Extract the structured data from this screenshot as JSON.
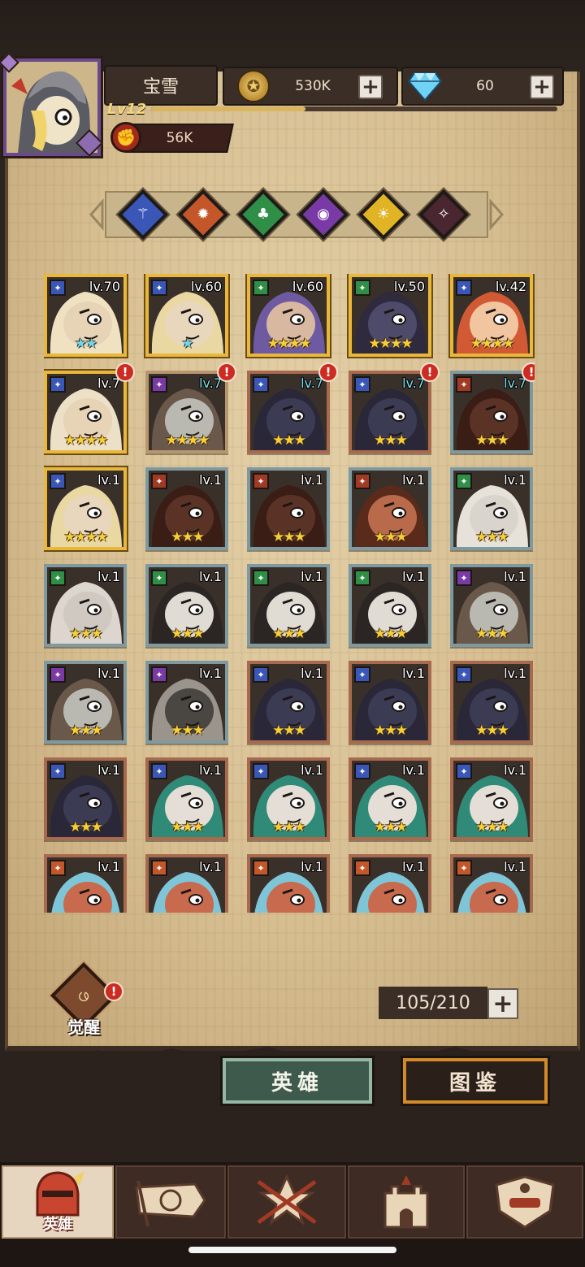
{
  "player": {
    "name": "宝雪",
    "level": "Lv12",
    "power": "56K",
    "xp_fraction": 0.38
  },
  "currencies": {
    "gold": "530K",
    "gems": "60"
  },
  "filters": [
    {
      "name": "filter-class-1",
      "color": "#3a57b8",
      "glyph": "⚚"
    },
    {
      "name": "filter-class-2",
      "color": "#c4572a",
      "glyph": "✹"
    },
    {
      "name": "filter-class-3",
      "color": "#2f8f46",
      "glyph": "♣"
    },
    {
      "name": "filter-class-4",
      "color": "#7a3aa6",
      "glyph": "◉"
    },
    {
      "name": "filter-class-5",
      "color": "#e1b425",
      "glyph": "☀"
    },
    {
      "name": "filter-class-6",
      "color": "#4a2630",
      "glyph": "✧"
    }
  ],
  "heroes": [
    {
      "level": "lv.70",
      "stars": "★★",
      "frame": "gold",
      "cls": "#3a57b8",
      "alert": false,
      "skin": "#e7d3b6",
      "hair": "#f0e2c0",
      "starcolor": "cyan"
    },
    {
      "level": "lv.60",
      "stars": "★",
      "frame": "gold",
      "cls": "#3a57b8",
      "alert": false,
      "skin": "#e8d7bd",
      "hair": "#ead8a3",
      "starcolor": "cyan"
    },
    {
      "level": "lv.60",
      "stars": "★★★★",
      "frame": "gold",
      "cls": "#2f8f46",
      "alert": false,
      "skin": "#d8b8a0",
      "hair": "#6e5aa0"
    },
    {
      "level": "lv.50",
      "stars": "★★★★",
      "frame": "gold",
      "cls": "#2f8f46",
      "alert": false,
      "skin": "#4e4a6a",
      "hair": "#2f2a3e"
    },
    {
      "level": "lv.42",
      "stars": "★★★★",
      "frame": "gold",
      "cls": "#3a57b8",
      "alert": false,
      "skin": "#f0c5a0",
      "hair": "#d15a34"
    },
    {
      "level": "lv.7",
      "stars": "★★★★",
      "frame": "gold",
      "cls": "#3a57b8",
      "alert": true,
      "skin": "#e7d3b6",
      "hair": "#ece0c6"
    },
    {
      "level": "lv.7",
      "stars": "★★★★",
      "frame": "purple",
      "cls": "#7a3aa6",
      "alert": true,
      "skin": "#b9b9b2",
      "hair": "#6a584a",
      "lvcolor": "cyan"
    },
    {
      "level": "lv.7",
      "stars": "★★★",
      "frame": "red",
      "cls": "#3a57b8",
      "alert": true,
      "skin": "#3c3b54",
      "hair": "#2a2838",
      "lvcolor": "cyan"
    },
    {
      "level": "lv.7",
      "stars": "★★★",
      "frame": "red",
      "cls": "#3a57b8",
      "alert": true,
      "skin": "#3c3b54",
      "hair": "#2a2838",
      "lvcolor": "cyan"
    },
    {
      "level": "lv.7",
      "stars": "★★★",
      "frame": "blue",
      "cls": "#a13a25",
      "alert": true,
      "skin": "#5a3326",
      "hair": "#3a1d14",
      "lvcolor": "cyan"
    },
    {
      "level": "lv.1",
      "stars": "★★★★",
      "frame": "gold",
      "cls": "#3a57b8",
      "alert": false,
      "skin": "#e8d7bd",
      "hair": "#ead8a3"
    },
    {
      "level": "lv.1",
      "stars": "★★★",
      "frame": "blue",
      "cls": "#a13a25",
      "alert": false,
      "skin": "#5a3326",
      "hair": "#3a1d14"
    },
    {
      "level": "lv.1",
      "stars": "★★★",
      "frame": "blue",
      "cls": "#a13a25",
      "alert": false,
      "skin": "#5a3326",
      "hair": "#3a1d14"
    },
    {
      "level": "lv.1",
      "stars": "★★★",
      "frame": "blue",
      "cls": "#a13a25",
      "alert": false,
      "skin": "#b86a4a",
      "hair": "#5a2a1a"
    },
    {
      "level": "lv.1",
      "stars": "★★★",
      "frame": "blue",
      "cls": "#2f8f46",
      "alert": false,
      "skin": "#d9d4cc",
      "hair": "#e6e2da"
    },
    {
      "level": "lv.1",
      "stars": "★★★",
      "frame": "blue",
      "cls": "#2f8f46",
      "alert": false,
      "skin": "#cfc9c1",
      "hair": "#dcd6cf"
    },
    {
      "level": "lv.1",
      "stars": "★★★",
      "frame": "blue",
      "cls": "#2f8f46",
      "alert": false,
      "skin": "#e0dcd4",
      "hair": "#2b2624"
    },
    {
      "level": "lv.1",
      "stars": "★★★",
      "frame": "blue",
      "cls": "#2f8f46",
      "alert": false,
      "skin": "#e0dcd4",
      "hair": "#2b2624"
    },
    {
      "level": "lv.1",
      "stars": "★★★",
      "frame": "blue",
      "cls": "#2f8f46",
      "alert": false,
      "skin": "#e0dcd4",
      "hair": "#2b2624"
    },
    {
      "level": "lv.1",
      "stars": "★★★",
      "frame": "blue",
      "cls": "#7a3aa6",
      "alert": false,
      "skin": "#b9b9b2",
      "hair": "#6a584a"
    },
    {
      "level": "lv.1",
      "stars": "★★★",
      "frame": "blue",
      "cls": "#7a3aa6",
      "alert": false,
      "skin": "#b9b9b2",
      "hair": "#6a584a"
    },
    {
      "level": "lv.1",
      "stars": "★★★",
      "frame": "blue",
      "cls": "#7a3aa6",
      "alert": false,
      "skin": "#4a4642",
      "hair": "#9a948c"
    },
    {
      "level": "lv.1",
      "stars": "★★★",
      "frame": "red",
      "cls": "#3a57b8",
      "alert": false,
      "skin": "#3c3b54",
      "hair": "#2a2838"
    },
    {
      "level": "lv.1",
      "stars": "★★★",
      "frame": "red",
      "cls": "#3a57b8",
      "alert": false,
      "skin": "#3c3b54",
      "hair": "#2a2838"
    },
    {
      "level": "lv.1",
      "stars": "★★★",
      "frame": "red",
      "cls": "#3a57b8",
      "alert": false,
      "skin": "#3c3b54",
      "hair": "#2a2838"
    },
    {
      "level": "lv.1",
      "stars": "★★★",
      "frame": "red",
      "cls": "#3a57b8",
      "alert": false,
      "skin": "#3c3b54",
      "hair": "#2a2838"
    },
    {
      "level": "lv.1",
      "stars": "★★★",
      "frame": "red",
      "cls": "#3a57b8",
      "alert": false,
      "skin": "#e4ded6",
      "hair": "#2f8a78"
    },
    {
      "level": "lv.1",
      "stars": "★★★",
      "frame": "red",
      "cls": "#3a57b8",
      "alert": false,
      "skin": "#e4ded6",
      "hair": "#2f8a78"
    },
    {
      "level": "lv.1",
      "stars": "★★★",
      "frame": "red",
      "cls": "#3a57b8",
      "alert": false,
      "skin": "#e4ded6",
      "hair": "#2f8a78"
    },
    {
      "level": "lv.1",
      "stars": "★★★",
      "frame": "red",
      "cls": "#3a57b8",
      "alert": false,
      "skin": "#e4ded6",
      "hair": "#2f8a78"
    },
    {
      "level": "lv.1",
      "stars": "",
      "frame": "red",
      "cls": "#c4572a",
      "alert": false,
      "skin": "#c86a4e",
      "hair": "#7ec5d8"
    },
    {
      "level": "lv.1",
      "stars": "",
      "frame": "red",
      "cls": "#c4572a",
      "alert": false,
      "skin": "#c86a4e",
      "hair": "#7ec5d8"
    },
    {
      "level": "lv.1",
      "stars": "",
      "frame": "red",
      "cls": "#c4572a",
      "alert": false,
      "skin": "#c86a4e",
      "hair": "#7ec5d8"
    },
    {
      "level": "lv.1",
      "stars": "",
      "frame": "red",
      "cls": "#c4572a",
      "alert": false,
      "skin": "#c86a4e",
      "hair": "#7ec5d8"
    },
    {
      "level": "lv.1",
      "stars": "",
      "frame": "red",
      "cls": "#c4572a",
      "alert": false,
      "skin": "#c86a4e",
      "hair": "#7ec5d8"
    }
  ],
  "awaken": {
    "label": "觉醒"
  },
  "capacity": "105/210",
  "tabs": {
    "heroes": "英雄",
    "codex": "图鉴"
  },
  "nav": {
    "heroes_label": "英雄"
  }
}
